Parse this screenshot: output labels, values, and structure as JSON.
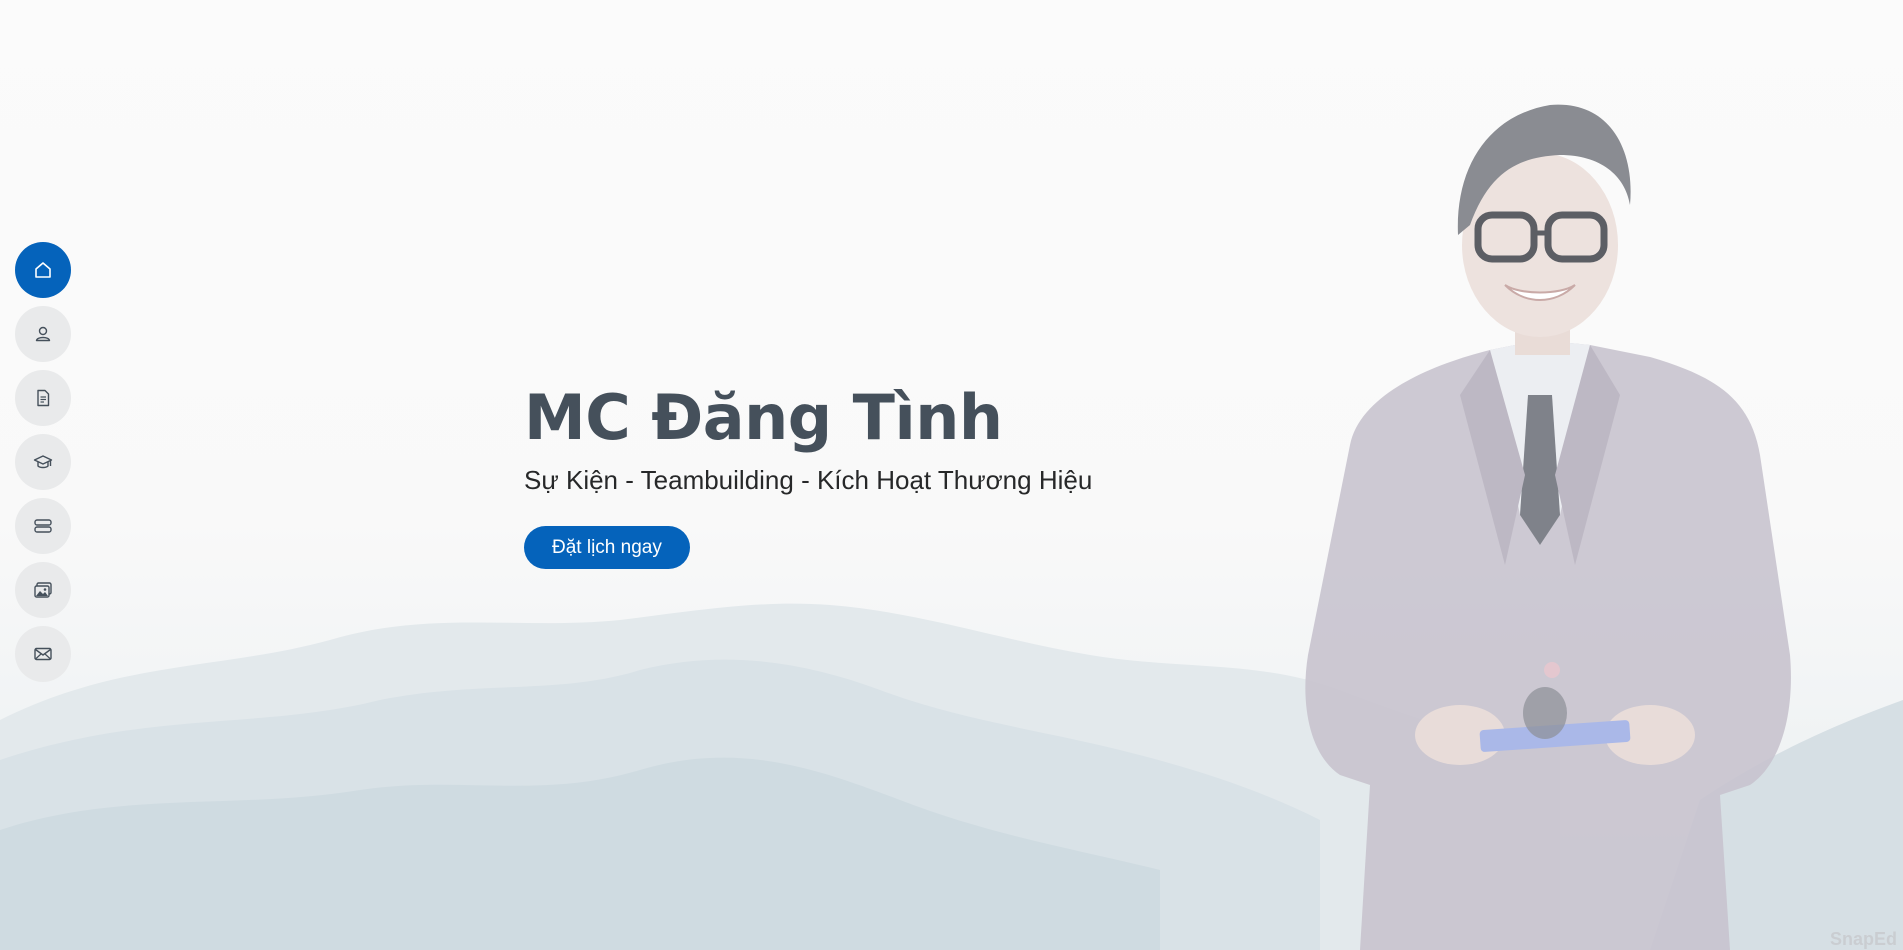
{
  "hero": {
    "title": "MC Đăng Tình",
    "subtitle": "Sự Kiện - Teambuilding - Kích Hoạt Thương Hiệu",
    "cta_label": "Đặt lịch ngay",
    "watermark": "SnapEd"
  },
  "side_nav": {
    "items": [
      {
        "icon": "home-icon",
        "active": true
      },
      {
        "icon": "person-icon",
        "active": false
      },
      {
        "icon": "file-text-icon",
        "active": false
      },
      {
        "icon": "graduation-cap-icon",
        "active": false
      },
      {
        "icon": "server-icon",
        "active": false
      },
      {
        "icon": "images-icon",
        "active": false
      },
      {
        "icon": "envelope-icon",
        "active": false
      }
    ]
  },
  "colors": {
    "accent": "#0563bb",
    "title": "#45505b",
    "subtitle": "#272829",
    "nav_bg": "#e9eaeb",
    "icon": "#45505b"
  }
}
